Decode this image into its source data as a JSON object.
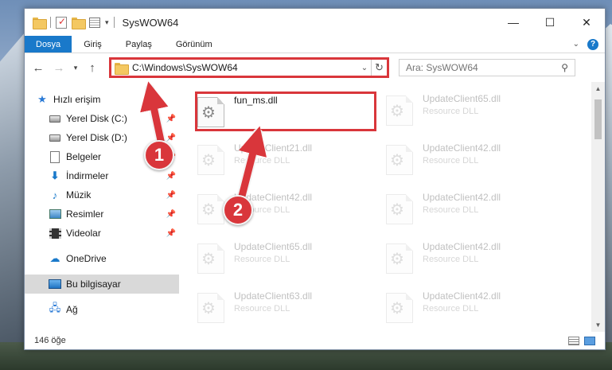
{
  "window": {
    "title": "SysWOW64"
  },
  "title_buttons": {
    "minimize": "—",
    "maximize": "☐",
    "close": "✕"
  },
  "ribbon": {
    "tabs": [
      "Dosya",
      "Giriş",
      "Paylaş",
      "Görünüm"
    ]
  },
  "address_bar": {
    "path": "C:\\Windows\\SysWOW64"
  },
  "search": {
    "placeholder": "Ara: SysWOW64"
  },
  "sidebar": {
    "items": [
      {
        "label": "Hızlı erişim",
        "icon": "star-icon"
      },
      {
        "label": "Yerel Disk (C:)",
        "icon": "drive-icon"
      },
      {
        "label": "Yerel Disk (D:)",
        "icon": "drive-icon"
      },
      {
        "label": "Belgeler",
        "icon": "document-icon"
      },
      {
        "label": "İndirmeler",
        "icon": "download-icon"
      },
      {
        "label": "Müzik",
        "icon": "music-icon"
      },
      {
        "label": "Resimler",
        "icon": "pictures-icon"
      },
      {
        "label": "Videolar",
        "icon": "videos-icon"
      },
      {
        "label": "OneDrive",
        "icon": "cloud-icon"
      },
      {
        "label": "Bu bilgisayar",
        "icon": "computer-icon"
      },
      {
        "label": "Ağ",
        "icon": "network-icon"
      }
    ]
  },
  "files": [
    {
      "name": "fun_ms.dll",
      "desc": ""
    },
    {
      "name": "UpdateClient65.dll",
      "desc": "Resource DLL"
    },
    {
      "name": "UpdateClient21.dll",
      "desc": "Resource DLL"
    },
    {
      "name": "UpdateClient42.dll",
      "desc": "Resource DLL"
    },
    {
      "name": "UpdateClient42.dll",
      "desc": "Resource DLL"
    },
    {
      "name": "UpdateClient42.dll",
      "desc": "Resource DLL"
    },
    {
      "name": "UpdateClient65.dll",
      "desc": "Resource DLL"
    },
    {
      "name": "UpdateClient42.dll",
      "desc": "Resource DLL"
    },
    {
      "name": "UpdateClient63.dll",
      "desc": "Resource DLL"
    },
    {
      "name": "UpdateClient42.dll",
      "desc": "Resource DLL"
    }
  ],
  "status": {
    "count": "146 öğe"
  },
  "callouts": [
    "1",
    "2"
  ],
  "colors": {
    "accent": "#1979ca",
    "highlight": "#d9363b"
  }
}
